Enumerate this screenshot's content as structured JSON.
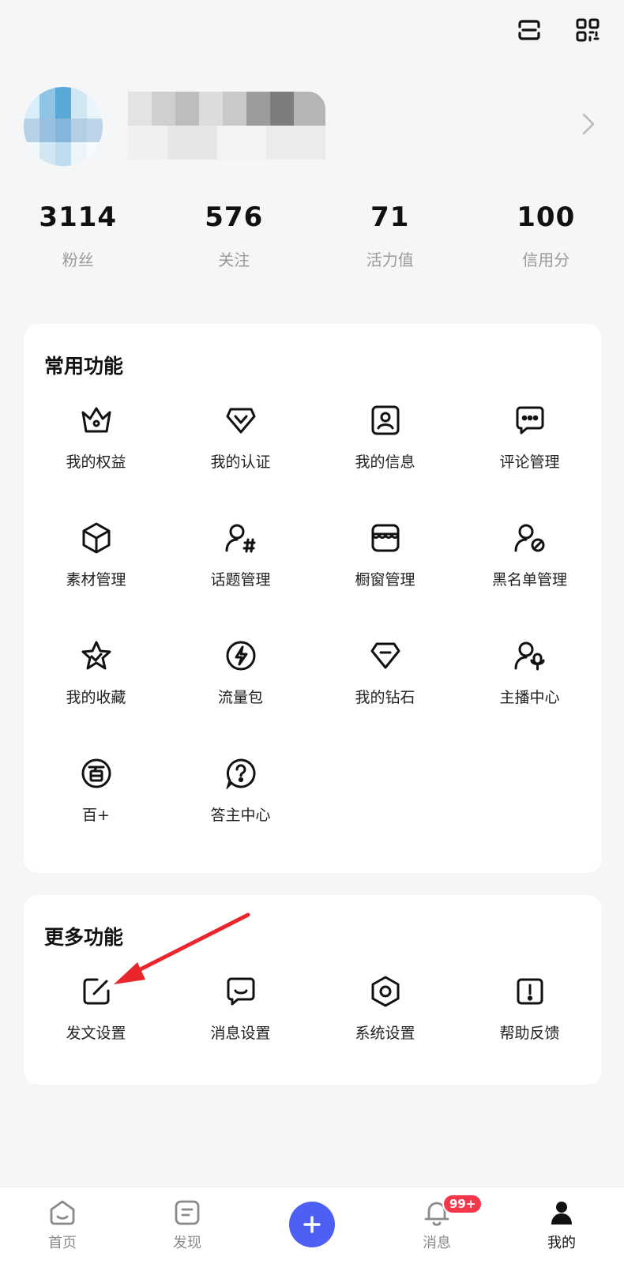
{
  "header": {
    "icons": [
      "scan-icon",
      "qr-code-icon"
    ]
  },
  "stats": [
    {
      "value": "3114",
      "label": "粉丝"
    },
    {
      "value": "576",
      "label": "关注"
    },
    {
      "value": "71",
      "label": "活力值"
    },
    {
      "value": "100",
      "label": "信用分"
    }
  ],
  "common": {
    "title": "常用功能",
    "items": [
      {
        "label": "我的权益",
        "icon": "crown-icon"
      },
      {
        "label": "我的认证",
        "icon": "badge-heart-icon"
      },
      {
        "label": "我的信息",
        "icon": "profile-card-icon"
      },
      {
        "label": "评论管理",
        "icon": "comment-icon"
      },
      {
        "label": "素材管理",
        "icon": "cube-icon"
      },
      {
        "label": "话题管理",
        "icon": "user-hashtag-icon"
      },
      {
        "label": "橱窗管理",
        "icon": "storefront-icon"
      },
      {
        "label": "黑名单管理",
        "icon": "user-block-icon"
      },
      {
        "label": "我的收藏",
        "icon": "star-icon"
      },
      {
        "label": "流量包",
        "icon": "lightning-icon"
      },
      {
        "label": "我的钻石",
        "icon": "diamond-icon"
      },
      {
        "label": "主播中心",
        "icon": "user-mic-icon"
      },
      {
        "label": "百+",
        "icon": "bai-plus-icon"
      },
      {
        "label": "答主中心",
        "icon": "question-icon"
      }
    ]
  },
  "more": {
    "title": "更多功能",
    "items": [
      {
        "label": "发文设置",
        "icon": "edit-icon"
      },
      {
        "label": "消息设置",
        "icon": "message-icon"
      },
      {
        "label": "系统设置",
        "icon": "settings-hex-icon"
      },
      {
        "label": "帮助反馈",
        "icon": "feedback-icon"
      }
    ]
  },
  "tabbar": {
    "tabs": [
      {
        "label": "首页",
        "icon": "home-icon"
      },
      {
        "label": "发现",
        "icon": "discover-icon"
      },
      {
        "label": "",
        "icon": "plus-icon"
      },
      {
        "label": "消息",
        "icon": "bell-icon",
        "badge": "99+"
      },
      {
        "label": "我的",
        "icon": "user-icon"
      }
    ]
  },
  "colors": {
    "accent": "#4e5ff4",
    "badge": "#f5374a",
    "annotation_arrow": "#e8262b"
  }
}
